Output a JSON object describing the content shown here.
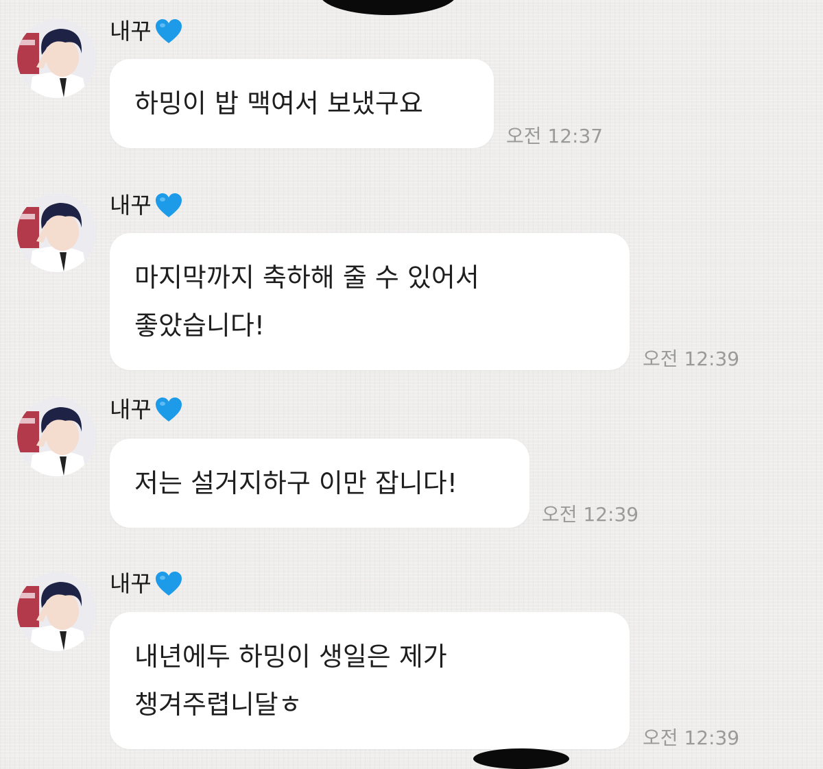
{
  "messages": [
    {
      "sender": "내꾸",
      "heart_icon": "blue-heart-icon",
      "lines": [
        "하밍이 밥 맥여서 보냈구요"
      ],
      "time": "오전 12:37"
    },
    {
      "sender": "내꾸",
      "heart_icon": "blue-heart-icon",
      "lines": [
        "마지막까지 축하해 줄 수 있어서",
        "좋았습니다!"
      ],
      "time": "오전 12:39"
    },
    {
      "sender": "내꾸",
      "heart_icon": "blue-heart-icon",
      "lines": [
        "저는 설거지하구 이만 잡니다!"
      ],
      "time": "오전 12:39"
    },
    {
      "sender": "내꾸",
      "heart_icon": "blue-heart-icon",
      "lines": [
        "내년에두 하밍이 생일은 제가",
        "챙겨주렵니달ㅎ"
      ],
      "time": "오전 12:39"
    }
  ],
  "colors": {
    "background": "#eeedec",
    "bubble": "#ffffff",
    "heart": "#1e9be8",
    "time_text": "#9a9a9a"
  }
}
